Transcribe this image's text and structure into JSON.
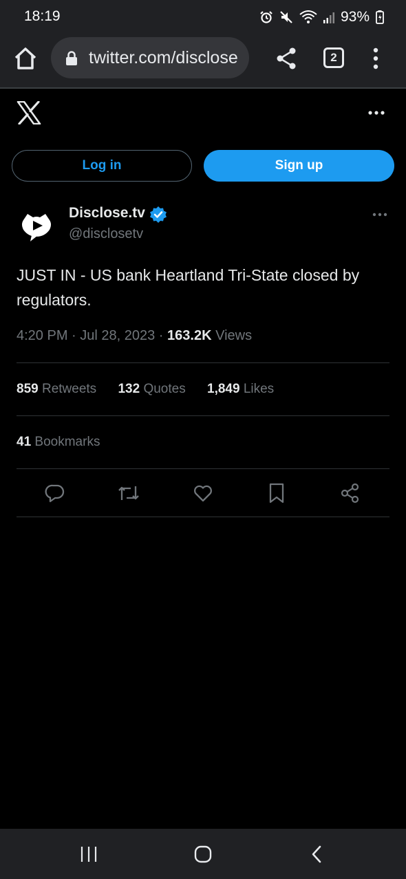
{
  "status": {
    "time": "18:19",
    "battery": "93%"
  },
  "browser": {
    "url": "twitter.com/disclose",
    "tab_count": "2"
  },
  "auth": {
    "login_label": "Log in",
    "signup_label": "Sign up"
  },
  "tweet": {
    "author_name": "Disclose.tv",
    "author_handle": "@disclosetv",
    "text": "JUST IN - US bank Heartland Tri-State closed by regulators.",
    "time": "4:20 PM",
    "separator1": " · ",
    "date": "Jul 28, 2023",
    "separator2": " · ",
    "views_count": "163.2K",
    "views_label": " Views",
    "stats": {
      "retweets_count": "859",
      "retweets_label": " Retweets",
      "quotes_count": "132",
      "quotes_label": " Quotes",
      "likes_count": "1,849",
      "likes_label": " Likes",
      "bookmarks_count": "41",
      "bookmarks_label": " Bookmarks"
    }
  },
  "icons": {
    "home": "home-icon",
    "lock": "lock-icon",
    "share": "share-icon",
    "menu": "more-vert-icon",
    "x_logo": "x-logo-icon",
    "more": "more-horizontal-icon",
    "verified": "verified-badge-icon",
    "reply": "reply-icon",
    "retweet": "retweet-icon",
    "like": "heart-icon",
    "bookmark": "bookmark-icon",
    "share_tweet": "share-icon"
  },
  "colors": {
    "accent": "#1d9bf0",
    "background": "#000000",
    "muted": "#71767b",
    "chrome": "#202124"
  }
}
